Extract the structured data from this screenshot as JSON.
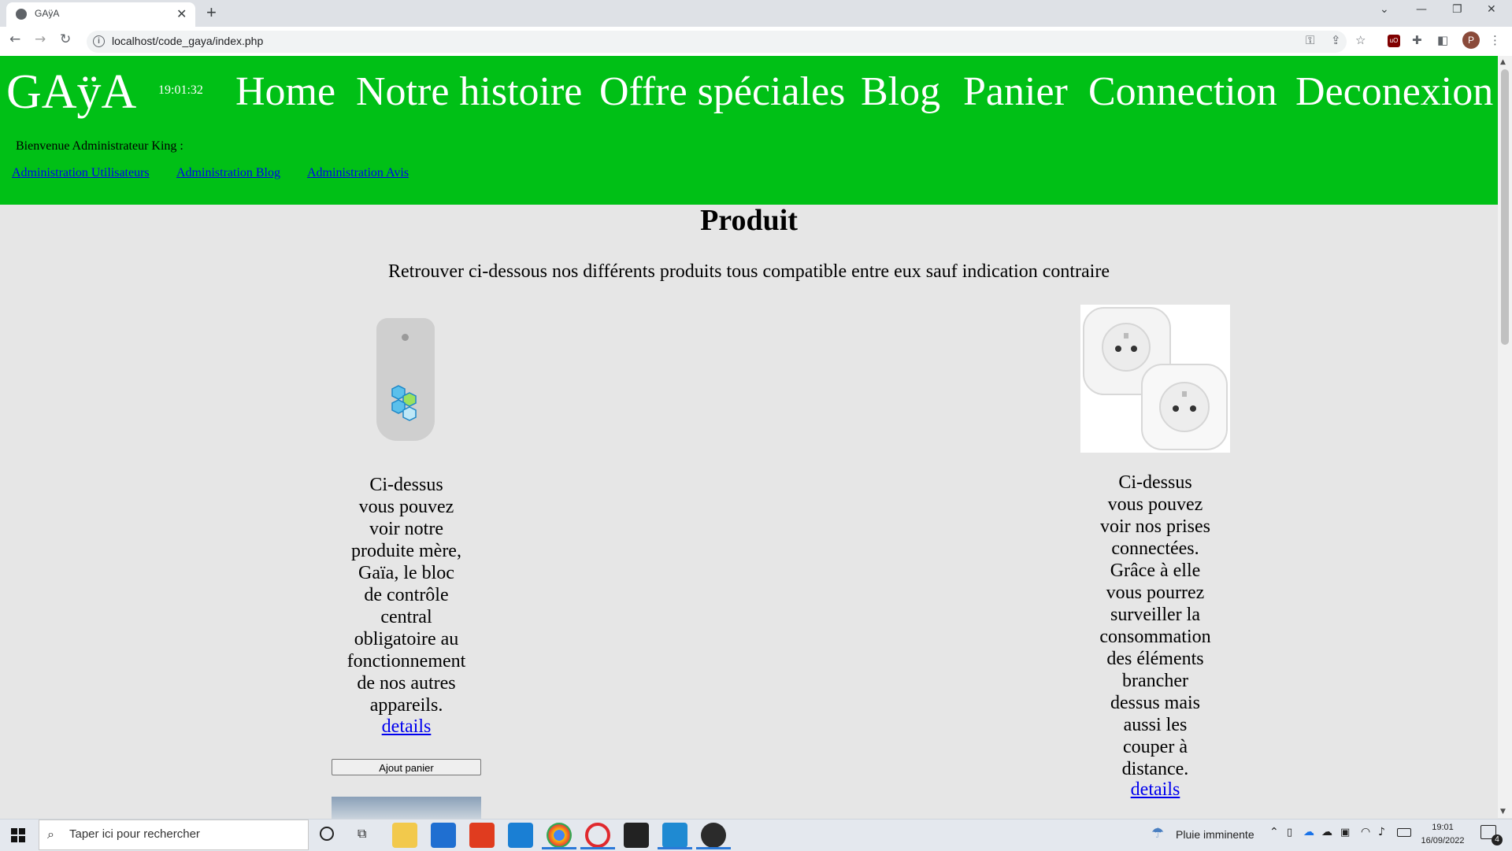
{
  "browser": {
    "tab_title": "GAÿA",
    "url": "localhost/code_gaya/index.php"
  },
  "site": {
    "logo": "GAÿA",
    "clock": "19:01:32",
    "nav": [
      "Home",
      "Notre histoire",
      "Offre spéciales",
      "Blog",
      "Panier",
      "Connection",
      "Deconexion"
    ],
    "welcome": "Bienvenue Administrateur King :",
    "admin_links": [
      "Administration Utilisateurs",
      "Administration Blog",
      "Administration Avis"
    ]
  },
  "main": {
    "title": "Produit",
    "intro": "Retrouver ci-dessous nos différents produits tous compatible entre eux sauf indication contraire",
    "products": [
      {
        "desc_lines": [
          "Ci-dessus",
          "vous pouvez",
          "voir notre",
          "produite mère,",
          "Gaïa, le bloc",
          "de contrôle",
          "central",
          "obligatoire au",
          "fonctionnement",
          "de nos autres",
          "appareils."
        ],
        "details": "details",
        "cart_button": "Ajout panier"
      },
      {
        "desc_lines": [
          "Ci-dessus",
          "vous pouvez",
          "voir nos prises",
          "connectées.",
          "Grâce à elle",
          "vous pourrez",
          "surveiller la",
          "consommation",
          "des éléments",
          "brancher",
          "dessus mais",
          "aussi les",
          "couper à",
          "distance."
        ],
        "details": "details"
      }
    ]
  },
  "taskbar": {
    "search_placeholder": "Taper ici pour rechercher",
    "weather": "Pluie imminente",
    "time": "19:01",
    "date": "16/09/2022",
    "notification_count": "4"
  },
  "icons": {
    "start": "windows-icon",
    "search": "search-icon",
    "cortana": "cortana-icon",
    "task_view": "task-view-icon"
  }
}
